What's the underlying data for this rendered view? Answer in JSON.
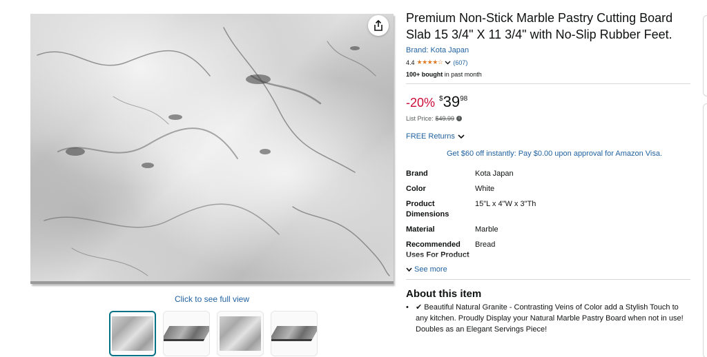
{
  "product": {
    "title": "Premium Non-Stick Marble Pastry Cutting Board Slab 15 3/4\" X 11 3/4\" with No-Slip Rubber Feet.",
    "brand_link": "Brand: Kota Japan",
    "rating_value": "4.4",
    "rating_stars": "★★★★☆",
    "rating_count": "(607)",
    "bought_bold": "100+ bought",
    "bought_rest": " in past month"
  },
  "price": {
    "discount": "-20%",
    "symbol": "$",
    "whole": "39",
    "fraction": "98",
    "list_label": "List Price:",
    "list_value": "$49.99"
  },
  "returns_label": "FREE Returns",
  "promo_text": "Get $60 off instantly: Pay $0.00 upon approval for Amazon Visa.",
  "specs": [
    {
      "key": "Brand",
      "value": "Kota Japan"
    },
    {
      "key": "Color",
      "value": "White"
    },
    {
      "key": "Product Dimensions",
      "value": "15\"L x 4\"W x 3\"Th"
    },
    {
      "key": "Material",
      "value": "Marble"
    },
    {
      "key": "Recommended Uses For Product",
      "value": "Bread"
    }
  ],
  "see_more": "See more",
  "about": {
    "title": "About this item",
    "bullets": [
      "✔ Beautiful Natural Granite - Contrasting Veins of Color add a Stylish Touch to any kitchen. Proudly Display your Natural Marble Pastry Board when not in use! Doubles as an Elegant Servings Piece!"
    ]
  },
  "gallery": {
    "full_view_text": "Click to see full view"
  },
  "colors": {
    "link": "#2162a1",
    "discount": "#cc0c39",
    "star": "#de7921",
    "active_thumb": "#007185"
  },
  "icons": [
    "share-icon",
    "chevron-down-icon",
    "info-icon",
    "checkmark-icon"
  ]
}
